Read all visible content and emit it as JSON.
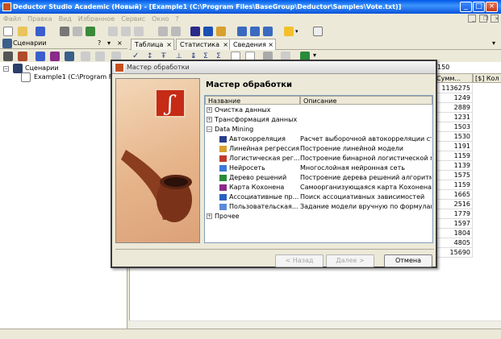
{
  "window": {
    "title": "Deductor Studio Academic (Новый) - [Example1  (C:\\Program Files\\BaseGroup\\Deductor\\Samples\\Vote.txt)]"
  },
  "menu": [
    "Файл",
    "Правка",
    "Вид",
    "Избранное",
    "Сервис",
    "Окно",
    "?"
  ],
  "panel": {
    "title": "Сценарии",
    "pin": "?",
    "root": "Сценарии",
    "child": "Example1  (C:\\Program Fil"
  },
  "tabs": [
    {
      "label": "Таблица"
    },
    {
      "label": "Статистика"
    },
    {
      "label": "Сведения"
    }
  ],
  "grid": {
    "top_value": "150",
    "col1": "Сумм...",
    "col2": "[$] Кол",
    "values": [
      "1136275",
      "1249",
      "2889",
      "1231",
      "1503",
      "1530",
      "1191",
      "1159",
      "1139",
      "1575",
      "1159",
      "1665",
      "2516",
      "1779",
      "1597",
      "1804",
      "4805",
      "15690"
    ]
  },
  "dialog": {
    "title": "Мастер обработки",
    "heading": "Мастер обработки",
    "col_name": "Название",
    "col_desc": "Описание",
    "groups": {
      "g1": "Очистка данных",
      "g2": "Трансформация данных",
      "g3": "Data Mining",
      "g4": "Прочее"
    },
    "items": [
      {
        "name": "Автокорреляция",
        "desc": "Расчет выборочной автокорреляции ст..."
      },
      {
        "name": "Линейная регрессия",
        "desc": "Построение линейной модели"
      },
      {
        "name": "Логистическая рег...",
        "desc": "Построение бинарной логистической м..."
      },
      {
        "name": "Нейросеть",
        "desc": "Многослойная нейронная сеть"
      },
      {
        "name": "Дерево решений",
        "desc": "Построение дерева решений алгоритм..."
      },
      {
        "name": "Карта Кохонена",
        "desc": "Самоорганизующаяся карта Кохонена"
      },
      {
        "name": "Ассоциативные пр...",
        "desc": "Поиск ассоциативных зависимостей"
      },
      {
        "name": "Пользовательская...",
        "desc": "Задание модели вручную по формулам"
      }
    ],
    "buttons": {
      "back": "< Назад",
      "next": "Далее >",
      "cancel": "Отмена"
    }
  },
  "colors": {
    "accent": "#0a52d8",
    "logo": "#c52b16"
  }
}
